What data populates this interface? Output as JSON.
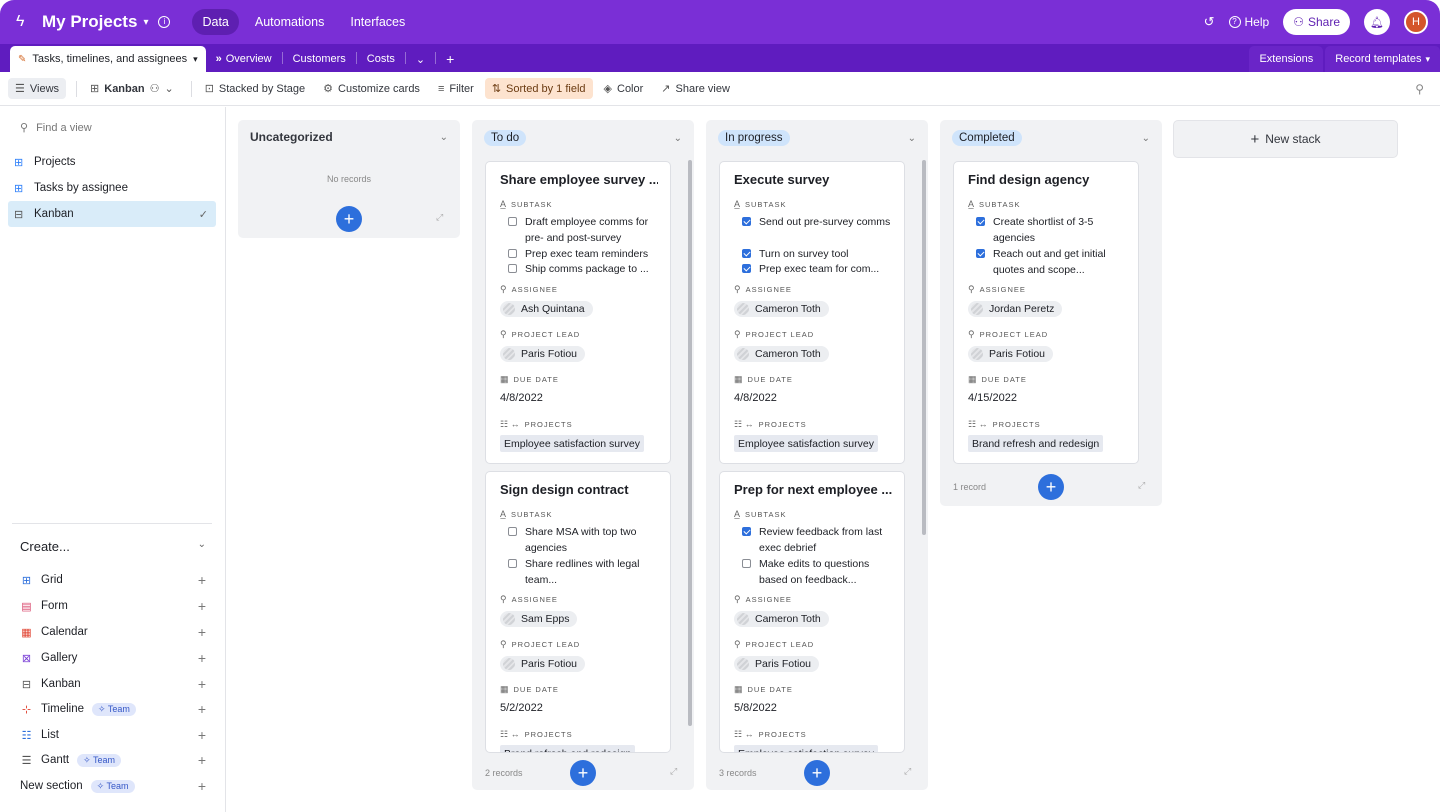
{
  "topbar": {
    "title": "My Projects",
    "nav": [
      "Data",
      "Automations",
      "Interfaces"
    ],
    "help": "Help",
    "share": "Share",
    "avatar": "H"
  },
  "tabs": {
    "active": "Tasks, timelines, and assignees",
    "items": [
      "Overview",
      "Customers",
      "Costs"
    ],
    "extensions": "Extensions",
    "record_templates": "Record templates"
  },
  "toolbar": {
    "views": "Views",
    "kanban": "Kanban",
    "stacked": "Stacked by Stage",
    "customize": "Customize cards",
    "filter": "Filter",
    "sorted": "Sorted by 1 field",
    "color": "Color",
    "share_view": "Share view"
  },
  "sidebar": {
    "find_placeholder": "Find a view",
    "views": [
      "Projects",
      "Tasks by assignee",
      "Kanban"
    ],
    "create_label": "Create...",
    "create_items": [
      "Grid",
      "Form",
      "Calendar",
      "Gallery",
      "Kanban",
      "Timeline",
      "List",
      "Gantt",
      "New section"
    ],
    "team_badge": "Team"
  },
  "stacks": {
    "uncategorized": {
      "title": "Uncategorized",
      "empty": "No records"
    },
    "todo": {
      "title": "To do",
      "count": "2 records"
    },
    "inprogress": {
      "title": "In progress",
      "count": "3 records"
    },
    "completed": {
      "title": "Completed",
      "count": "1 record"
    },
    "new_stack": "New stack"
  },
  "labels": {
    "subtask": "SUBTASK",
    "assignee": "ASSIGNEE",
    "project_lead": "PROJECT LEAD",
    "due_date": "DUE DATE",
    "projects": "PROJECTS"
  },
  "cards": {
    "c1": {
      "title": "Share employee survey ...",
      "subtasks": [
        {
          "text": "Draft employee comms for pre- and post-survey",
          "done": false
        },
        {
          "text": "Prep exec team reminders",
          "done": false
        },
        {
          "text": "Ship comms package to ...",
          "done": false
        }
      ],
      "assignee": "Ash Quintana",
      "lead": "Paris Fotiou",
      "due": "4/8/2022",
      "project": "Employee satisfaction survey"
    },
    "c2": {
      "title": "Sign design contract",
      "subtasks": [
        {
          "text": "Share MSA with top two agencies",
          "done": false
        },
        {
          "text": "Share redlines with legal team...",
          "done": false
        }
      ],
      "assignee": "Sam Epps",
      "lead": "Paris Fotiou",
      "due": "5/2/2022",
      "project": "Brand refresh and redesign"
    },
    "c3": {
      "title": "Execute survey",
      "subtasks": [
        {
          "text": "Send out pre-survey comms",
          "done": true
        },
        {
          "text": "Turn on survey tool",
          "done": true
        },
        {
          "text": "Prep exec team for com...",
          "done": true
        }
      ],
      "assignee": "Cameron Toth",
      "lead": "Cameron Toth",
      "due": "4/8/2022",
      "project": "Employee satisfaction survey"
    },
    "c4": {
      "title": "Prep for next employee ...",
      "subtasks": [
        {
          "text": "Review feedback from last exec debrief",
          "done": true
        },
        {
          "text": "Make edits to questions based on feedback...",
          "done": false
        }
      ],
      "assignee": "Cameron Toth",
      "lead": "Paris Fotiou",
      "due": "5/8/2022",
      "project": "Employee satisfaction survey"
    },
    "c5": {
      "title": "Find design agency",
      "subtasks": [
        {
          "text": "Create shortlist of 3-5 agencies",
          "done": true
        },
        {
          "text": "Reach out and get initial quotes and scope...",
          "done": true
        }
      ],
      "assignee": "Jordan Peretz",
      "lead": "Paris Fotiou",
      "due": "4/15/2022",
      "project": "Brand refresh and redesign"
    }
  },
  "colors": {
    "topbar": "#7a2fd6",
    "tabsbar": "#5f1cbf",
    "accent": "#2d6fdc",
    "todo_pill": "#cfe4fb",
    "inprogress_pill": "#cfe4fb",
    "completed_pill": "#cfe4fb"
  }
}
